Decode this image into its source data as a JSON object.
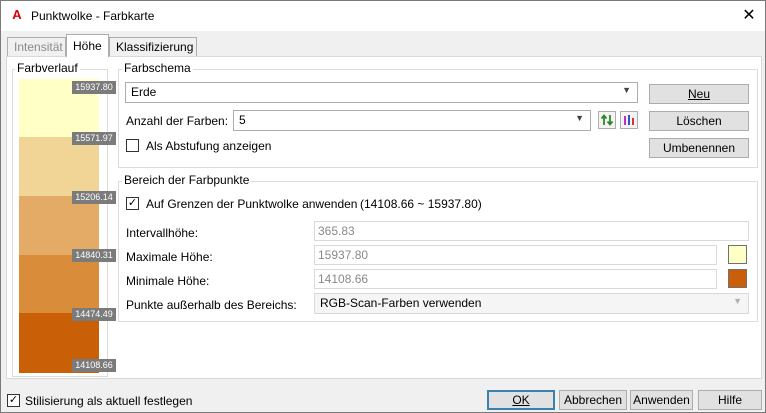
{
  "window": {
    "title": "Punktwolke - Farbkarte",
    "close_glyph": "✕"
  },
  "tabs": [
    {
      "label": "Intensität"
    },
    {
      "label": "Höhe"
    },
    {
      "label": "Klassifizierung"
    }
  ],
  "gradient": {
    "group_label": "Farbverlauf",
    "ticks": [
      "15937.80",
      "15571.97",
      "15206.14",
      "14840.31",
      "14474.49",
      "14108.66"
    ],
    "colors": [
      "#ffffc6",
      "#f0d596",
      "#e3ab66",
      "#d98c3a",
      "#c95f07"
    ]
  },
  "scheme": {
    "group_label": "Farbschema",
    "selected": "Erde",
    "count_label": "Anzahl der Farben:",
    "count_value": "5",
    "show_steps_label": "Als Abstufung anzeigen",
    "show_steps_checked": false
  },
  "buttons": {
    "new": "Neu",
    "delete": "Löschen",
    "rename": "Umbenennen",
    "ok": "OK",
    "cancel": "Abbrechen",
    "apply": "Anwenden",
    "help": "Hilfe"
  },
  "range": {
    "group_label": "Bereich der Farbpunkte",
    "apply_bounds_label": "Auf Grenzen der Punktwolke anwenden",
    "apply_bounds_range": "(14108.66 ~ 15937.80)",
    "apply_bounds_checked": true,
    "interval_label": "Intervallhöhe:",
    "interval_value": "365.83",
    "max_label": "Maximale Höhe:",
    "max_value": "15937.80",
    "max_color": "#ffffc6",
    "min_label": "Minimale Höhe:",
    "min_value": "14108.66",
    "min_color": "#c95f07",
    "outside_label": "Punkte außerhalb des Bereichs:",
    "outside_value": "RGB-Scan-Farben verwenden"
  },
  "footer": {
    "stylize_label": "Stilisierung als aktuell festlegen",
    "stylize_checked": true
  }
}
